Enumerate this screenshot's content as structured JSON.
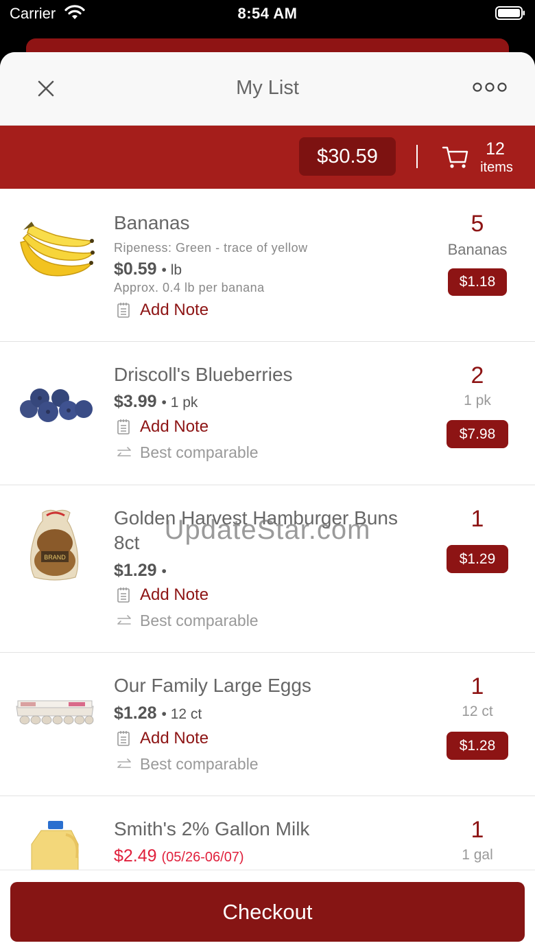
{
  "status_bar": {
    "carrier": "Carrier",
    "time": "8:54 AM"
  },
  "header": {
    "title": "My List"
  },
  "summary": {
    "total": "$30.59",
    "item_count": "12",
    "items_label": "items"
  },
  "colors": {
    "brand": "#a51e1b",
    "brand_dark": "#861514",
    "sale": "#e0203c"
  },
  "items": [
    {
      "name": "Bananas",
      "detail": "Ripeness: Green - trace of yellow",
      "price": "$0.59",
      "unit": "lb",
      "approx": "Approx. 0.4 lb per banana",
      "note_label": "Add Note",
      "qty": "5",
      "qty_unit": "Bananas",
      "line_total": "$1.18"
    },
    {
      "name": "Driscoll's Blueberries",
      "price": "$3.99",
      "unit": "1 pk",
      "note_label": "Add Note",
      "comparable_label": "Best comparable",
      "qty": "2",
      "qty_unit": "1 pk",
      "line_total": "$7.98"
    },
    {
      "name": "Golden Harvest Hamburger Buns 8ct",
      "price": "$1.29",
      "note_label": "Add Note",
      "comparable_label": "Best comparable",
      "qty": "1",
      "line_total": "$1.29"
    },
    {
      "name": "Our Family Large Eggs",
      "price": "$1.28",
      "unit": "12 ct",
      "note_label": "Add Note",
      "comparable_label": "Best comparable",
      "qty": "1",
      "qty_unit": "12 ct",
      "line_total": "$1.28"
    },
    {
      "name": "Smith's 2% Gallon Milk",
      "sale_price": "$2.49",
      "sale_dates": "(05/26-06/07)",
      "qty": "1",
      "qty_unit": "1 gal"
    }
  ],
  "watermark": "UpdateStar.com",
  "checkout": {
    "label": "Checkout"
  }
}
